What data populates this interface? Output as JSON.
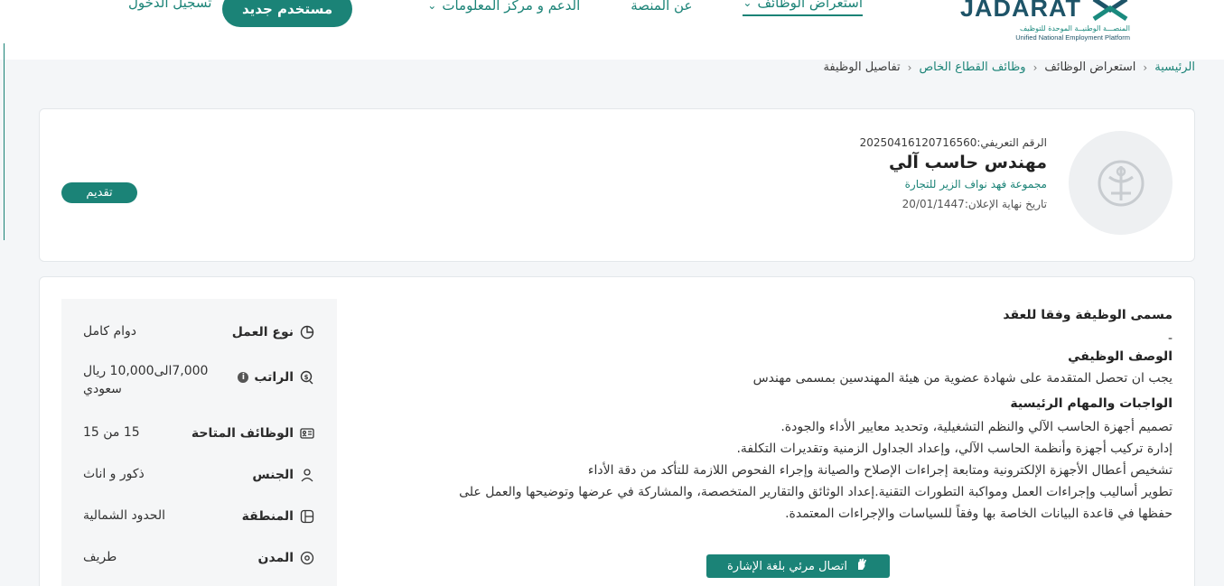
{
  "header": {
    "logo_text": "JADARAT",
    "logo_arabic": "المنصـــة الوطنيــة الموحدة للتوظيف",
    "logo_english": "Unified National Employment Platform",
    "nav": [
      {
        "label": "استعراض الوظائف",
        "has_dropdown": true,
        "active": true
      },
      {
        "label": "عن المنصة",
        "has_dropdown": false,
        "active": false
      },
      {
        "label": "الدعم و مركز المعلومات",
        "has_dropdown": true,
        "active": false
      }
    ],
    "new_user_label": "مستخدم جديد",
    "login_label": "تسجيل الدخول"
  },
  "breadcrumb": {
    "home": "الرئيسية",
    "browse": "استعراض الوظائف",
    "private": "وظائف القطاع الخاص",
    "current": "تفاصيل الوظيفة"
  },
  "job": {
    "id_text": "الرقم التعريفي:20250416120716560",
    "title": "مهندس حاسب آلي",
    "company": "مجموعة فهد نواف الزير للتجارة",
    "deadline_text": "تاريخ نهاية الإعلان:20/01/1447",
    "apply_label": "تقديم"
  },
  "details": {
    "side": [
      {
        "icon": "pie-chart-icon",
        "label": "نوع العمل",
        "value": "دوام كامل"
      },
      {
        "icon": "money-icon",
        "label": "الراتب",
        "value_line1": "7,000الى10,000 ريال",
        "value_line2": "سعودي"
      },
      {
        "icon": "id-card-icon",
        "label": "الوظائف المتاحة",
        "value": "15 من 15"
      },
      {
        "icon": "person-icon",
        "label": "الجنس",
        "value": "ذكور و اناث"
      },
      {
        "icon": "map-icon",
        "label": "المنطقة",
        "value": "الحدود الشمالية"
      },
      {
        "icon": "location-pin-icon",
        "label": "المدن",
        "value": "طريف"
      }
    ],
    "contract_title_heading": "مسمى الوظيفة وفقا للعقد",
    "contract_title_value": "-",
    "description_heading": "الوصف الوظيفي",
    "description": "يجب ان تحصل المتقدمة على شهادة عضوية من هيئة المهندسين بمسمى مهندس",
    "duties_heading": "الواجبات والمهام الرئيسية",
    "duties": [
      "تصميم أجهزة الحاسب الآلي والنظم التشغيلية، وتحديد معايير الأداء والجودة.",
      "إدارة تركيب أجهزة وأنظمة الحاسب الآلي، وإعداد الجداول الزمنية وتقديرات التكلفة.",
      "تشخيص أعطال الأجهزة الإلكترونية ومتابعة إجراءات الإصلاح والصيانة وإجراء الفحوص اللازمة للتأكد من دقة الأداء",
      "تطوير أساليب وإجراءات العمل ومواكبة التطورات التقنية.إعداد الوثائق والتقارير المتخصصة، والمشاركة في عرضها وتوضيحها والعمل على",
      "حفظها في قاعدة البيانات الخاصة بها وفقاً للسياسات والإجراءات المعتمدة."
    ]
  },
  "sign_language_label": "اتصال مرئي بلغة الإشارة",
  "colors": {
    "primary": "#1b8377",
    "brand_dark": "#1e5468"
  }
}
